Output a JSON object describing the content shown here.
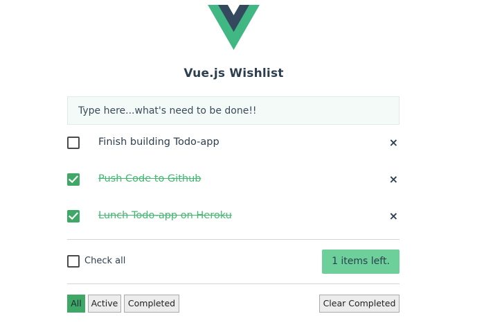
{
  "colors": {
    "vue_green": "#41b883",
    "vue_dark": "#35495e",
    "accent_green": "#3fa867",
    "badge_green": "#6dd09a"
  },
  "header": {
    "logo": "vue-logo-icon",
    "title": "Vue.js Wishlist"
  },
  "new_todo": {
    "placeholder": "Type here...what's need to be done!!",
    "value": ""
  },
  "todos": [
    {
      "text": "Finish building Todo-app",
      "completed": false,
      "remove_icon": "×"
    },
    {
      "text": "Push Code to Github",
      "completed": true,
      "remove_icon": "×"
    },
    {
      "text": "Lunch Todo-app on Heroku",
      "completed": true,
      "remove_icon": "×"
    }
  ],
  "footer": {
    "check_all_label": "Check all",
    "check_all_checked": false,
    "items_left": "1 items left."
  },
  "filters": {
    "all": "All",
    "active": "Active",
    "completed": "Completed",
    "selected": "All",
    "clear_completed": "Clear Completed"
  }
}
